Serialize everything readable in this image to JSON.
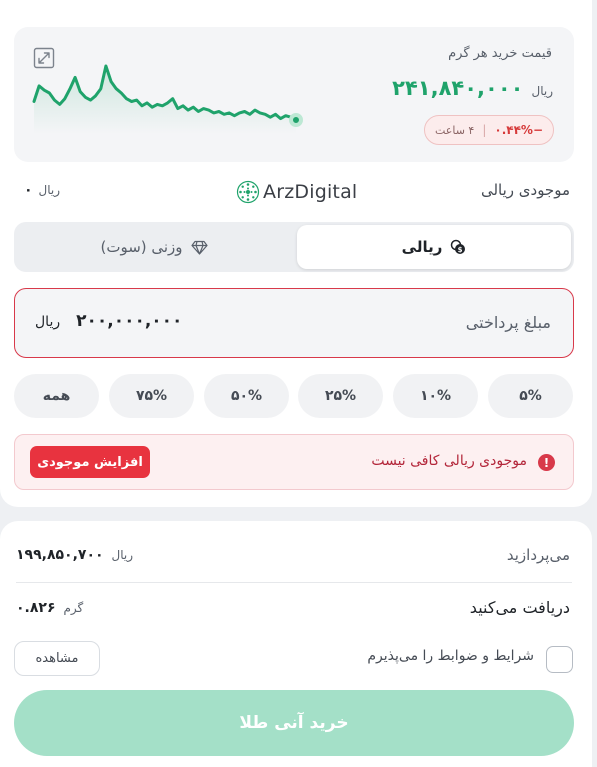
{
  "price": {
    "title": "قیمت خرید هر گرم",
    "value": "۲۴۱,۸۴۰,۰۰۰",
    "unit": "ریال",
    "change_pct": "−۰.۴۴%",
    "change_period": "۴ ساعت",
    "accent_color": "#1fa36b",
    "negative_color": "#d63a3a"
  },
  "balance": {
    "label": "موجودی ریالی",
    "logo_text": "ArzDigital",
    "value": "۰",
    "unit": "ریال"
  },
  "tabs": [
    {
      "label": "ریالی",
      "icon": "coins-icon",
      "active": true
    },
    {
      "label": "وزنی (سوت)",
      "icon": "diamond-icon",
      "active": false
    }
  ],
  "payment": {
    "label": "مبلغ پرداختی",
    "value": "۲۰۰,۰۰۰,۰۰۰",
    "unit": "ریال",
    "error_color": "#d8394a"
  },
  "percent_buttons": [
    "۵%",
    "۱۰%",
    "۲۵%",
    "۵۰%",
    "۷۵%",
    "همه"
  ],
  "warning": {
    "text": "موجودی ریالی کافی نیست",
    "icon_glyph": "!",
    "action_label": "افزایش موجودی"
  },
  "summary": {
    "pay_label": "می‌پردازید",
    "pay_value": "۱۹۹,۸۵۰,۷۰۰",
    "pay_unit": "ریال",
    "receive_label": "دریافت می‌کنید",
    "receive_value": "۰.۸۲۶",
    "receive_unit": "گرم"
  },
  "terms": {
    "label": "شرایط و ضوابط را می‌پذیرم",
    "checked": false,
    "view_label": "مشاهده"
  },
  "buy_button": {
    "label": "خرید آنی طلا",
    "disabled": true,
    "color": "#a4e0c8"
  },
  "sparkline": {
    "values": [
      71,
      82,
      79,
      77,
      72,
      69,
      73,
      80,
      88,
      78,
      74,
      72,
      75,
      80,
      96,
      85,
      80,
      77,
      73,
      71,
      72,
      68,
      70,
      67,
      69,
      68,
      70,
      73,
      66,
      68,
      65,
      67,
      64,
      66,
      65,
      63,
      64,
      62,
      63,
      61,
      63,
      64,
      62,
      65,
      63,
      62,
      60,
      62,
      59,
      61,
      60,
      58
    ]
  }
}
